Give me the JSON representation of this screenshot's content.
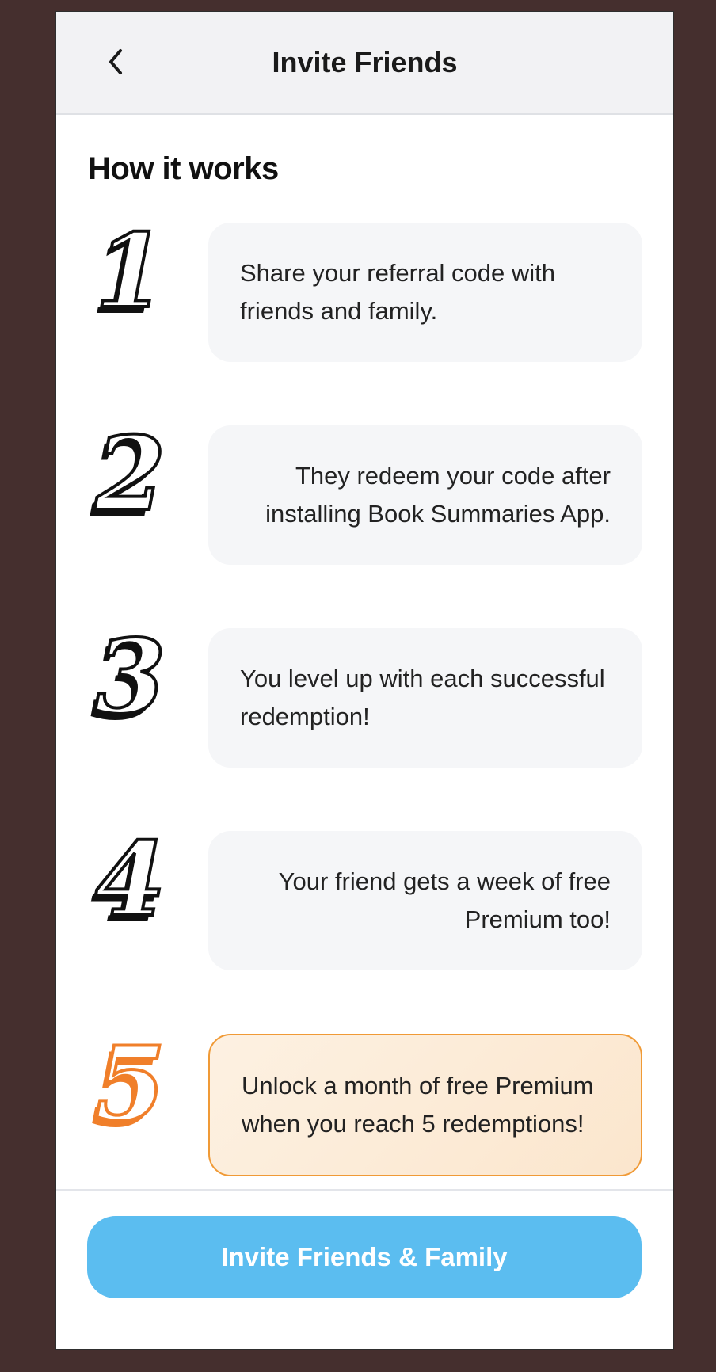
{
  "nav": {
    "title": "Invite Friends",
    "back_icon": "chevron-left-icon"
  },
  "section": {
    "title": "How it works"
  },
  "steps": [
    {
      "number": "1",
      "text": "Share your referral code with friends and family.",
      "align": "left",
      "highlight": false
    },
    {
      "number": "2",
      "text": "They redeem your code after installing Book Summaries App.",
      "align": "right",
      "highlight": false
    },
    {
      "number": "3",
      "text": "You level up with each successful redemption!",
      "align": "left",
      "highlight": false
    },
    {
      "number": "4",
      "text": "Your friend gets a week of free Premium too!",
      "align": "right",
      "highlight": false
    },
    {
      "number": "5",
      "text": "Unlock a month of free Premium when you reach 5 redemptions!",
      "align": "left",
      "highlight": true
    }
  ],
  "cta": {
    "label": "Invite Friends & Family"
  },
  "colors": {
    "background": "#452f2e",
    "nav_bg": "#f2f2f4",
    "card_bg": "#f5f6f8",
    "highlight_border": "#f09a36",
    "highlight_number": "#f07f2a",
    "button": "#5bbdf0"
  }
}
